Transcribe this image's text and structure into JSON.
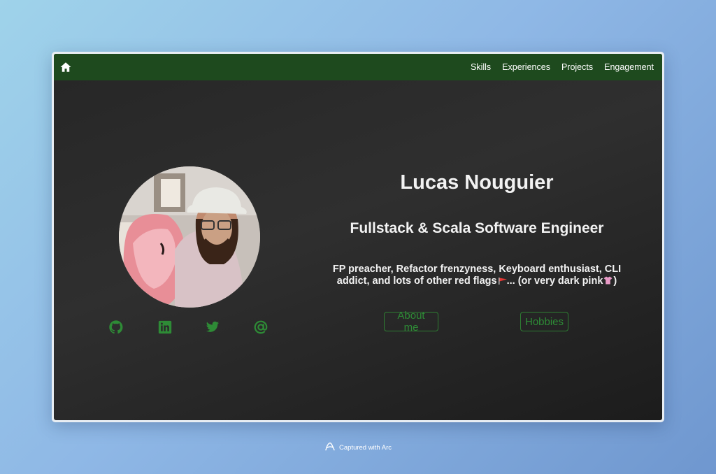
{
  "nav": {
    "home_icon": "home-icon",
    "items": [
      "Skills",
      "Experiences",
      "Projects",
      "Engagement"
    ]
  },
  "hero": {
    "name": "Lucas Nouguier",
    "role": "Fullstack & Scala Software Engineer",
    "tagline_part1": "FP preacher, Refactor frenzyness, Keyboard enthusiast, CLI addict, and lots of other red flags",
    "tagline_part2": "... (or very dark pink",
    "tagline_part3": ")",
    "buttons": {
      "about": "About me",
      "hobbies": "Hobbies"
    }
  },
  "socials": [
    "github-icon",
    "linkedin-icon",
    "twitter-icon",
    "email-icon"
  ],
  "caption": {
    "text": "Captured with Arc"
  },
  "colors": {
    "navbar": "#1e4a1e",
    "accent_green": "#2e8b36",
    "text": "#f2f2f2",
    "background": "#2a2a2a"
  }
}
